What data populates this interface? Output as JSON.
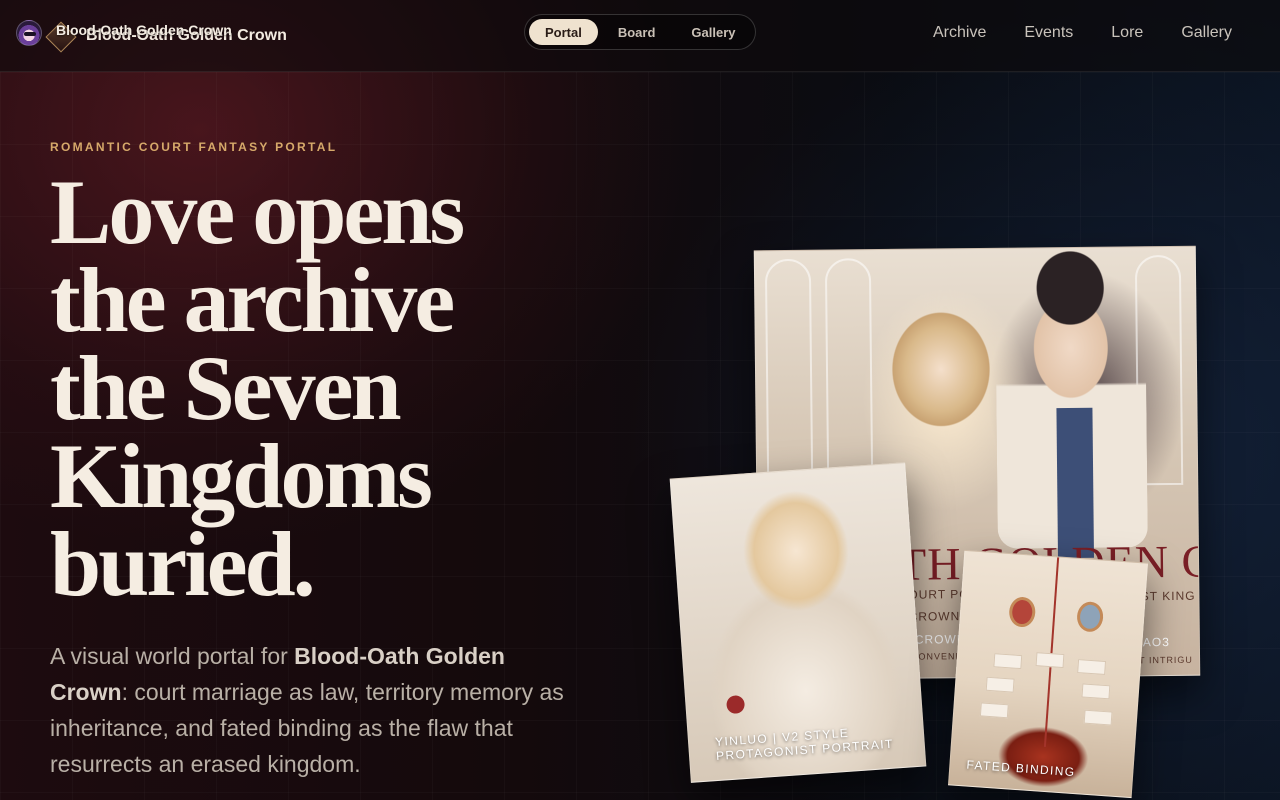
{
  "header": {
    "brand_overlay": "Blood-Oath Golden Crown",
    "brand_title": "Blood-Oath Golden Crown",
    "segments": [
      {
        "label": "Portal",
        "active": true
      },
      {
        "label": "Board",
        "active": false
      },
      {
        "label": "Gallery",
        "active": false
      }
    ],
    "nav": [
      "Archive",
      "Events",
      "Lore",
      "Gallery"
    ]
  },
  "hero": {
    "eyebrow": "ROMANTIC COURT FANTASY PORTAL",
    "headline_lines": [
      "Love opens",
      "the archive",
      "the Seven",
      "Kingdoms",
      "buried."
    ],
    "lede_intro": "A visual world portal for ",
    "lede_bold": "Blood-Oath Golden Crown",
    "lede_rest": ": court marriage as law, territory memory as inheritance, and fated binding as the flaw that resurrects an erased kingdom."
  },
  "cards": {
    "poster": {
      "title_fragment": "TH GOLDEN CRO",
      "line1": "OURT POLITI",
      "line2": "OST KING",
      "line3": "CROWN, SH",
      "line4": "CROWN",
      "line5": "AO3",
      "line6": "CONVENIENCE",
      "line7": "T INTRIGU"
    },
    "portrait": {
      "label_line1": "YINLUO | V2 STYLE",
      "label_line2": "PROTAGONIST PORTRAIT"
    },
    "binding": {
      "label": "FATED BINDING"
    }
  },
  "colors": {
    "accent_gold": "#d6a96a",
    "headline": "#f5ede2",
    "poster_title": "#7a1f26"
  }
}
